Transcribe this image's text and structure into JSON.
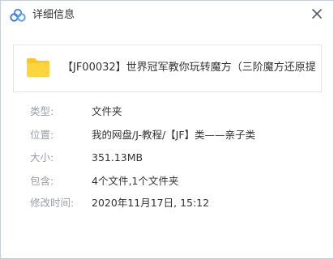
{
  "window": {
    "title": "详细信息"
  },
  "file": {
    "name": "【JF00032】世界冠军教你玩转魔方（三阶魔方还原提…"
  },
  "details": [
    {
      "label": "类型:",
      "value": "文件夹"
    },
    {
      "label": "位置:",
      "value": "我的网盘/J-教程/【JF】类——亲子类"
    },
    {
      "label": "大小:",
      "value": "351.13MB"
    },
    {
      "label": "包含:",
      "value": "4个文件,1个文件夹"
    },
    {
      "label": "修改时间:",
      "value": "2020年11月17日, 15:12"
    }
  ],
  "colors": {
    "accent": "#4a8af4",
    "folder": "#ffc629"
  },
  "icons": {
    "app": "cloud-logo-icon",
    "close": "close-icon",
    "file": "folder-icon"
  }
}
